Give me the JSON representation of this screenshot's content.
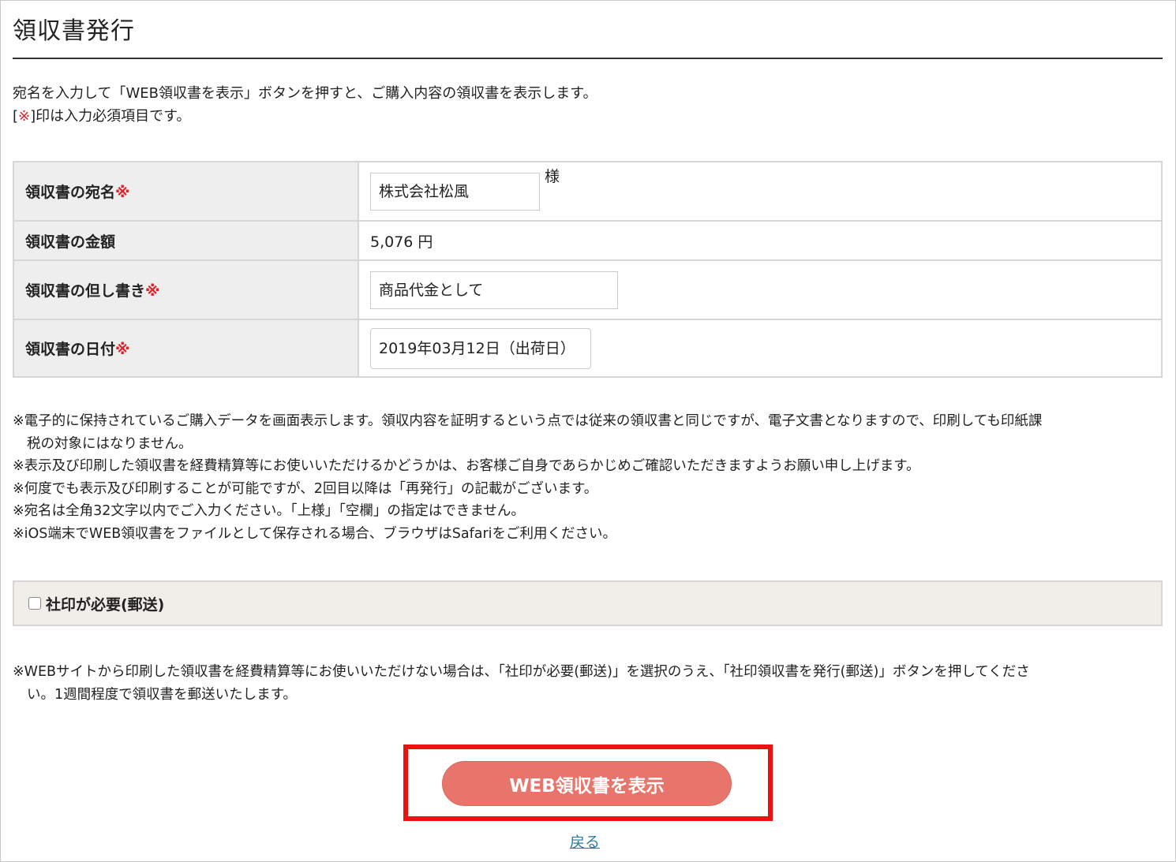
{
  "page": {
    "title": "領収書発行",
    "intro_line1": "宛名を入力して「WEB領収書を表示」ボタンを押すと、ご購入内容の領収書を表示します。",
    "intro_bracket_open": "[",
    "intro_req_mark": "※",
    "intro_line2_rest": "]印は入力必須項目です。"
  },
  "form": {
    "required_mark": "※",
    "rows": [
      {
        "label": "領収書の宛名",
        "required": true,
        "value": "株式会社松風",
        "suffix": "様"
      },
      {
        "label": "領収書の金額",
        "required": false,
        "value": "5,076 円"
      },
      {
        "label": "領収書の但し書き",
        "required": true,
        "value": "商品代金として"
      },
      {
        "label": "領収書の日付",
        "required": true,
        "value": "2019年03月12日（出荷日）"
      }
    ]
  },
  "notes": [
    {
      "line1": "※電子的に保持されているご購入データを画面表示します。領収内容を証明するという点では従来の領収書と同じですが、電子文書となりますので、印刷しても印紙課",
      "line2": "税の対象にはなりません。"
    },
    {
      "line1": "※表示及び印刷した領収書を経費精算等にお使いいただけるかどうかは、お客様ご自身であらかじめご確認いただきますようお願い申し上げます。"
    },
    {
      "line1": "※何度でも表示及び印刷することが可能ですが、2回目以降は「再発行」の記載がございます。"
    },
    {
      "line1": "※宛名は全角32文字以内でご入力ください。「上様」「空欄」の指定はできません。"
    },
    {
      "line1": "※iOS端末でWEB領収書をファイルとして保存される場合、ブラウザはSafariをご利用ください。"
    }
  ],
  "stamp_option": {
    "label": "社印が必要(郵送)",
    "checked": false
  },
  "stamp_note": {
    "line1": "※WEBサイトから印刷した領収書を経費精算等にお使いいただけない場合は、「社印が必要(郵送)」を選択のうえ、「社印領収書を発行(郵送)」ボタンを押してくださ",
    "line2": "い。1週間程度で領収書を郵送いたします。"
  },
  "actions": {
    "primary_label": "WEB領収書を表示",
    "back_label": "戻る"
  },
  "colors": {
    "required": "#d8232a",
    "primary_button": "#e8756b",
    "highlight_border": "#ee1111",
    "link": "#2a7a9c",
    "label_bg": "#eeeeee",
    "option_bg": "#f1eeea"
  }
}
